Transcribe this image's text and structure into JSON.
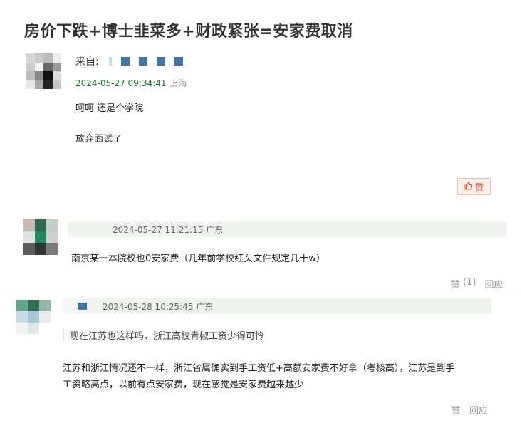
{
  "title": "房价下跌+博士韭菜多+财政紧张=安家费取消",
  "post": {
    "from_label": "来自:",
    "timestamp": "2024-05-27 09:34:41",
    "location": "上海",
    "lines": [
      "呵呵 还是个学院",
      "放弃面试了"
    ],
    "like_label": "赞"
  },
  "comment1": {
    "timestamp": "2024-05-27 11:21:15",
    "location": "广东",
    "text": "南京某一本院校也0安家费（几年前学校红头文件规定几十w）",
    "like_label": "赞",
    "like_count": "(1)",
    "reply_label": "回应"
  },
  "comment2": {
    "timestamp": "2024-05-28 10:25:45",
    "location": "广东",
    "quote": "现在江苏也这样吗，浙江高校青椒工资少得可怜",
    "text_line1": "江苏和浙江情况还不一样，浙江省属确实到手工资低+高额安家费不好拿（考核高），江苏是到手",
    "text_line2": "工资略高点，以前有点安家费，现在感觉是安家费越来越少",
    "like_label": "赞",
    "reply_label": "回应"
  },
  "colors": {
    "accent_green": "#1a7a35",
    "like_red": "#e5523a",
    "bar_bg": "#eef3ee"
  }
}
